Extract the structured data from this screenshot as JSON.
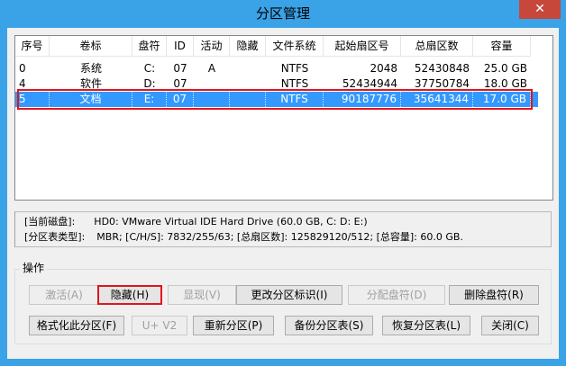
{
  "window": {
    "title": "分区管理",
    "close_glyph": "✕"
  },
  "list": {
    "columns": [
      "序号",
      "卷标",
      "盘符",
      "ID",
      "活动",
      "隐藏",
      "文件系统",
      "起始扇区号",
      "总扇区数",
      "容量"
    ],
    "rows": [
      {
        "index": "0",
        "label": "系统",
        "drive": "C:",
        "id": "07",
        "active": "A",
        "hidden": "",
        "fs": "NTFS",
        "start": "2048",
        "sectors": "52430848",
        "size": "25.0 GB"
      },
      {
        "index": "4",
        "label": "软件",
        "drive": "D:",
        "id": "07",
        "active": "",
        "hidden": "",
        "fs": "NTFS",
        "start": "52434944",
        "sectors": "37750784",
        "size": "18.0 GB"
      },
      {
        "index": "5",
        "label": "文档",
        "drive": "E:",
        "id": "07",
        "active": "",
        "hidden": "",
        "fs": "NTFS",
        "start": "90187776",
        "sectors": "35641344",
        "size": "17.0 GB"
      }
    ]
  },
  "disk_info": {
    "current_disk_label": "[当前磁盘]:",
    "current_disk_value": "HD0: VMware Virtual IDE Hard Drive (60.0 GB, C: D: E:)",
    "table_type_label": "[分区表类型]:",
    "table_type_value": "MBR;    [C/H/S]: 7832/255/63; [总扇区数]: 125829120/512; [总容量]: 60.0 GB."
  },
  "operations": {
    "group_label": "操作",
    "activate": "激活(A)",
    "hide": "隐藏(H)",
    "show": "显现(V)",
    "change_id": "更改分区标识(I)",
    "assign_drive": "分配盘符(D)",
    "remove_drive": "删除盘符(R)",
    "format": "格式化此分区(F)",
    "u_v2": "U+ V2",
    "repartition": "重新分区(P)",
    "backup_table": "备份分区表(S)",
    "restore_table": "恢复分区表(L)",
    "close": "关闭(C)"
  }
}
